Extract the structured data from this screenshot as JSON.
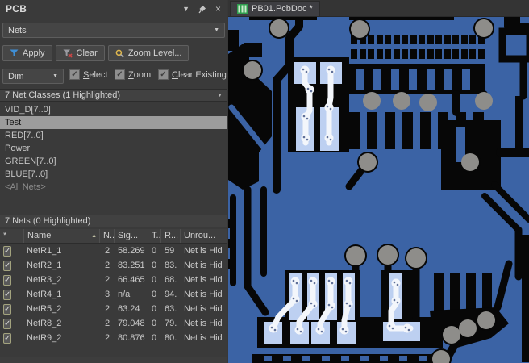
{
  "ui": {
    "menu_glyph": "▼",
    "close_glyph": "×",
    "arrow_down": "▼",
    "check_glyph": "✓",
    "sort_glyph": "▲"
  },
  "panel": {
    "title": "PCB",
    "mode": "Nets",
    "apply_label": "Apply",
    "clear_label": "Clear",
    "zoom_level_label": "Zoom Level...",
    "dim_mode": "Dim",
    "checkbox_select": "Select",
    "checkbox_zoom": "Zoom",
    "checkbox_clear_existing": "Clear Existing",
    "classes_header": "7 Net Classes (1 Highlighted)",
    "classes": [
      "VID_D[7..0]",
      "Test",
      "RED[7..0]",
      "Power",
      "GREEN[7..0]",
      "BLUE[7..0]",
      "<All Nets>"
    ],
    "selected_class": "Test",
    "nets_header": "7 Nets (0 Highlighted)",
    "columns": {
      "check": "*",
      "name": "Name",
      "nodes": "N..",
      "signal": "Sig...",
      "t": "T...",
      "r": "R...",
      "unrouted": "Unrou..."
    },
    "rows": [
      {
        "name": "NetR1_1",
        "nodes": "2",
        "signal": "58.269",
        "t": "0",
        "r": "59",
        "unrouted": "Net is Hid"
      },
      {
        "name": "NetR2_1",
        "nodes": "2",
        "signal": "83.251",
        "t": "0",
        "r": "83.",
        "unrouted": "Net is Hid"
      },
      {
        "name": "NetR3_2",
        "nodes": "2",
        "signal": "66.465",
        "t": "0",
        "r": "68.",
        "unrouted": "Net is Hid"
      },
      {
        "name": "NetR4_1",
        "nodes": "3",
        "signal": "n/a",
        "t": "0",
        "r": "94.",
        "unrouted": "Net is Hid"
      },
      {
        "name": "NetR5_2",
        "nodes": "2",
        "signal": "63.24",
        "t": "0",
        "r": "63.",
        "unrouted": "Net is Hid"
      },
      {
        "name": "NetR8_2",
        "nodes": "2",
        "signal": "79.048",
        "t": "0",
        "r": "79.",
        "unrouted": "Net is Hid"
      },
      {
        "name": "NetR9_2",
        "nodes": "2",
        "signal": "80.876",
        "t": "0",
        "r": "80.",
        "unrouted": "Net is Hid"
      }
    ]
  },
  "editor": {
    "tab_label": "PB01.PcbDoc *",
    "colors": {
      "copper": "#3b63a5",
      "substrate": "#070707",
      "via": "#8e8d8a",
      "highlight_trace": "#f3f6fb",
      "highlight_pad": "#bdd0f1"
    }
  }
}
